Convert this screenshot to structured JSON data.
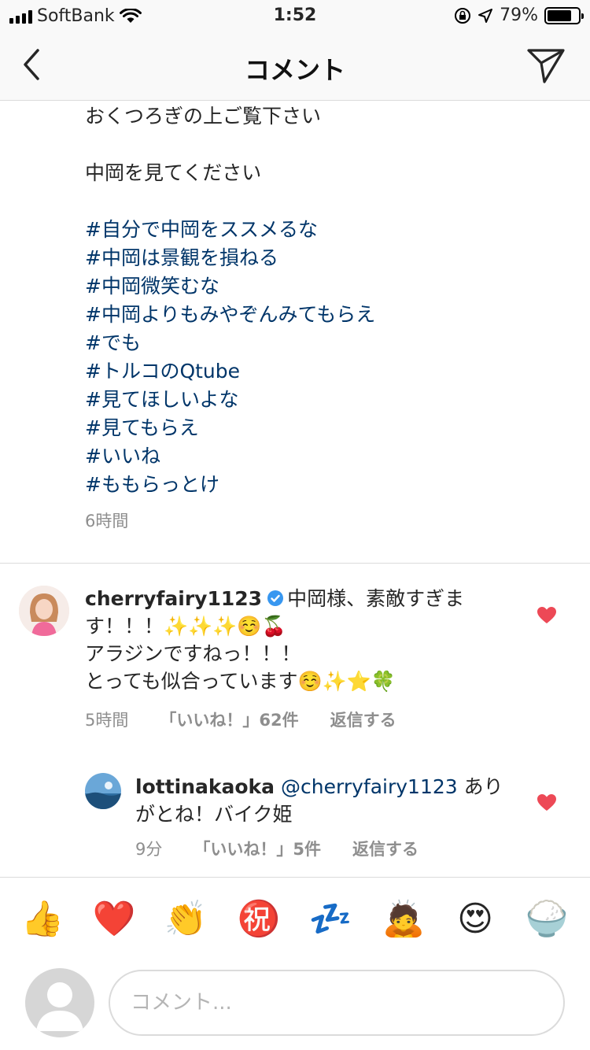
{
  "status_bar": {
    "carrier": "SoftBank",
    "time": "1:52",
    "battery": "79%",
    "battery_level": 0.79
  },
  "nav": {
    "title": "コメント",
    "icons": [
      "back-chevron-icon",
      "send-icon"
    ]
  },
  "caption": {
    "lines": [
      "おくつろぎの上ご覧下さい",
      "中岡を見てください"
    ],
    "hashtags": [
      "#自分で中岡をススメるな",
      "#中岡は景観を損ねる",
      "#中岡微笑むな",
      "#中岡よりもみやぞんみてもらえ",
      "#でも",
      "#トルコのQtube",
      "#見てほしいよな",
      "#見てもらえ",
      "#いいね",
      "#ももらっとけ"
    ],
    "time": "6時間"
  },
  "comments": [
    {
      "username": "cherryfairy1123",
      "verified": true,
      "text": "中岡様、素敵すぎます！！！✨✨✨☺️🍒",
      "text2": "アラジンですねっ！！！",
      "text3": "とっても似合っています☺️✨⭐️🍀",
      "time": "5時間",
      "likes": "「いいね！」62件",
      "reply": "返信する",
      "liked": true,
      "like_color": "#ed4956"
    },
    {
      "username": "lottinakaoka",
      "mention": "@cherryfairy1123",
      "text": "ありがとね！バイク姫",
      "time": "9分",
      "likes": "「いいね！」5件",
      "reply": "返信する",
      "liked": true
    }
  ],
  "emoji_bar": [
    "👍",
    "❤️",
    "👏",
    "㊗️",
    "💤",
    "🙇",
    "😍",
    "🍚"
  ],
  "comment_input": {
    "placeholder": "コメント..."
  },
  "colors": {
    "hashtag": "#003569",
    "secondary_text": "#8e8e8e",
    "heart": "#ed4956",
    "verified": "#3897f0"
  }
}
